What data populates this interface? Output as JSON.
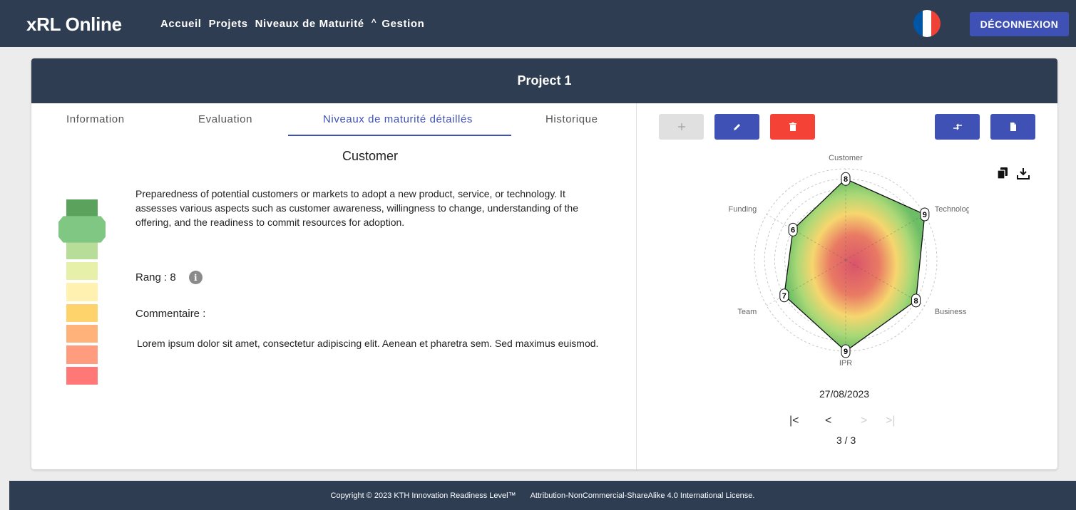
{
  "app": {
    "title": "xRL Online"
  },
  "nav": {
    "home": "Accueil",
    "projects": "Projets",
    "maturity_levels": "Niveaux de Maturité",
    "management": "Gestion"
  },
  "header": {
    "logout_label": "DÉCONNEXION",
    "flag_colors": [
      "#0055a4",
      "#ffffff",
      "#ef4135"
    ]
  },
  "project": {
    "title": "Project 1"
  },
  "tabs": [
    "Information",
    "Evaluation",
    "Niveaux de maturité détaillés",
    "Historique"
  ],
  "detail": {
    "title": "Customer",
    "description": "Preparedness of potential customers or markets to adopt a new product, service, or technology. It assesses various aspects such as customer awareness, willingness to change, understanding of the offering, and the readiness to commit resources for adoption.",
    "rank_label": "Rang : 8",
    "comment_label": "Commentaire :",
    "comment": "Lorem ipsum dolor sit amet, consectetur adipiscing elit. Aenean et pharetra sem. Sed maximus euismod.",
    "level_ladder": {
      "levels": 9,
      "current": 8,
      "colors": [
        "#5ba35d",
        "#80c783",
        "#b8dd98",
        "#e6f0a8",
        "#fff2b0",
        "#ffd36b",
        "#ffb37a",
        "#ff9c7d",
        "#ff7777"
      ]
    }
  },
  "toolbar": {
    "add_icon": "plus-icon",
    "edit_icon": "pencil-icon",
    "delete_icon": "trash-icon",
    "compare_icon": "compare-icon",
    "report_icon": "file-icon",
    "colors": {
      "primary": "#3f51b5",
      "danger": "#f44336",
      "disabled": "#e0e0e0"
    }
  },
  "radar": {
    "copy_icon": "copy-icon",
    "download_icon": "download-icon",
    "axes": [
      "Customer",
      "Technology",
      "Business Model",
      "IPR",
      "Team",
      "Funding"
    ],
    "values": [
      8,
      9,
      8,
      9,
      7,
      6
    ],
    "max": 9,
    "date": "27/08/2023"
  },
  "pagination": {
    "first": "|<",
    "prev": "<",
    "next": ">",
    "last": ">|",
    "current_label": "3 / 3"
  },
  "footer": {
    "copyright": "Copyright © 2023 KTH Innovation Readiness Level™",
    "license": "Attribution-NonCommercial-ShareAlike 4.0 International License."
  }
}
